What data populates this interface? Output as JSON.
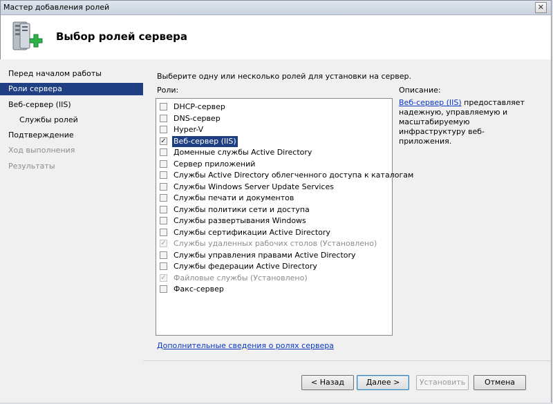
{
  "window": {
    "title": "Мастер добавления ролей",
    "close_label": "✕"
  },
  "header": {
    "title": "Выбор ролей сервера"
  },
  "nav": {
    "items": [
      {
        "label": "Перед началом работы",
        "state": "normal"
      },
      {
        "label": "Роли сервера",
        "state": "active"
      },
      {
        "label": "Веб-сервер (IIS)",
        "state": "normal"
      },
      {
        "label": "Службы ролей",
        "state": "sub"
      },
      {
        "label": "Подтверждение",
        "state": "normal"
      },
      {
        "label": "Ход выполнения",
        "state": "disabled"
      },
      {
        "label": "Результаты",
        "state": "disabled"
      }
    ]
  },
  "main": {
    "instruction": "Выберите одну или несколько ролей для установки на сервер.",
    "roles_label": "Роли:",
    "roles": [
      {
        "label": "DHCP-сервер",
        "checked": false,
        "disabled": false
      },
      {
        "label": "DNS-сервер",
        "checked": false,
        "disabled": false
      },
      {
        "label": "Hyper-V",
        "checked": false,
        "disabled": false
      },
      {
        "label": "Веб-сервер (IIS)",
        "checked": true,
        "disabled": false,
        "selected": true
      },
      {
        "label": "Доменные службы Active Directory",
        "checked": false,
        "disabled": false
      },
      {
        "label": "Сервер приложений",
        "checked": false,
        "disabled": false
      },
      {
        "label": "Службы Active Directory облегченного доступа к каталогам",
        "checked": false,
        "disabled": false
      },
      {
        "label": "Службы Windows Server Update Services",
        "checked": false,
        "disabled": false
      },
      {
        "label": "Службы печати и документов",
        "checked": false,
        "disabled": false
      },
      {
        "label": "Службы политики сети и доступа",
        "checked": false,
        "disabled": false
      },
      {
        "label": "Службы развертывания Windows",
        "checked": false,
        "disabled": false
      },
      {
        "label": "Службы сертификации Active Directory",
        "checked": false,
        "disabled": false
      },
      {
        "label": "Службы удаленных рабочих столов  (Установлено)",
        "checked": true,
        "disabled": true
      },
      {
        "label": "Службы управления правами Active Directory",
        "checked": false,
        "disabled": false
      },
      {
        "label": "Службы федерации Active Directory",
        "checked": false,
        "disabled": false
      },
      {
        "label": "Файловые службы  (Установлено)",
        "checked": true,
        "disabled": true
      },
      {
        "label": "Факс-сервер",
        "checked": false,
        "disabled": false
      }
    ],
    "more_link": "Дополнительные сведения о ролях сервера"
  },
  "description": {
    "title": "Описание:",
    "link": "Веб-сервер (IIS)",
    "text": " предоставляет надежную, управляемую и масштабируемую инфраструктуру веб-приложения."
  },
  "buttons": {
    "back": "< Назад",
    "next": "Далее >",
    "install": "Установить",
    "cancel": "Отмена"
  },
  "icons": {
    "header": "server-add-icon",
    "check": "✓"
  },
  "colors": {
    "selection": "#1e3f82",
    "link": "#0a37c2"
  }
}
